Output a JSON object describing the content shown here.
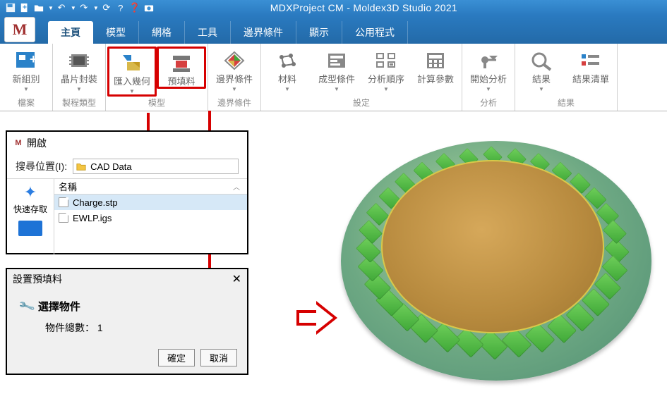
{
  "titlebar": {
    "title": "MDXProject CM - Moldex3D Studio 2021"
  },
  "app_icon_letter": "M",
  "tabs": [
    {
      "label": "主頁",
      "active": true
    },
    {
      "label": "模型"
    },
    {
      "label": "網格"
    },
    {
      "label": "工具"
    },
    {
      "label": "邊界條件"
    },
    {
      "label": "顯示"
    },
    {
      "label": "公用程式"
    }
  ],
  "ribbon": {
    "groups": [
      {
        "title": "檔案",
        "buttons": [
          {
            "label": "新組別",
            "dd": true,
            "icon": "new-group-icon"
          }
        ]
      },
      {
        "title": "製程類型",
        "buttons": [
          {
            "label": "晶片封裝",
            "dd": true,
            "icon": "chip-pack-icon"
          }
        ]
      },
      {
        "title": "模型",
        "buttons": [
          {
            "label": "匯入幾何",
            "dd": true,
            "icon": "import-geom-icon",
            "hilite": true
          },
          {
            "label": "預填料",
            "dd": false,
            "icon": "prefill-icon",
            "hilite": true
          }
        ]
      },
      {
        "title": "邊界條件",
        "buttons": [
          {
            "label": "邊界條件",
            "dd": true,
            "icon": "bc-icon"
          }
        ]
      },
      {
        "title": "設定",
        "buttons": [
          {
            "label": "材料",
            "dd": true,
            "icon": "material-icon"
          },
          {
            "label": "成型條件",
            "dd": true,
            "icon": "mold-cond-icon"
          },
          {
            "label": "分析順序",
            "dd": true,
            "icon": "analysis-order-icon"
          },
          {
            "label": "計算參數",
            "dd": false,
            "icon": "calc-param-icon"
          }
        ]
      },
      {
        "title": "分析",
        "buttons": [
          {
            "label": "開始分析",
            "dd": true,
            "icon": "start-analysis-icon"
          }
        ]
      },
      {
        "title": "結果",
        "buttons": [
          {
            "label": "結果",
            "dd": true,
            "icon": "result-icon"
          },
          {
            "label": "結果清單",
            "dd": false,
            "icon": "result-list-icon"
          }
        ]
      }
    ]
  },
  "filedlg": {
    "title": "開啟",
    "search_label": "搜尋位置(I):",
    "folder": "CAD Data",
    "side_quick": "快速存取",
    "col_name": "名稱",
    "files": [
      {
        "name": "Charge.stp",
        "selected": true
      },
      {
        "name": "EWLP.igs",
        "selected": false
      }
    ]
  },
  "smalldlg": {
    "title": "設置預填料",
    "heading": "選擇物件",
    "count_label": "物件總數：",
    "count_value": "1",
    "ok": "確定",
    "cancel": "取消"
  }
}
